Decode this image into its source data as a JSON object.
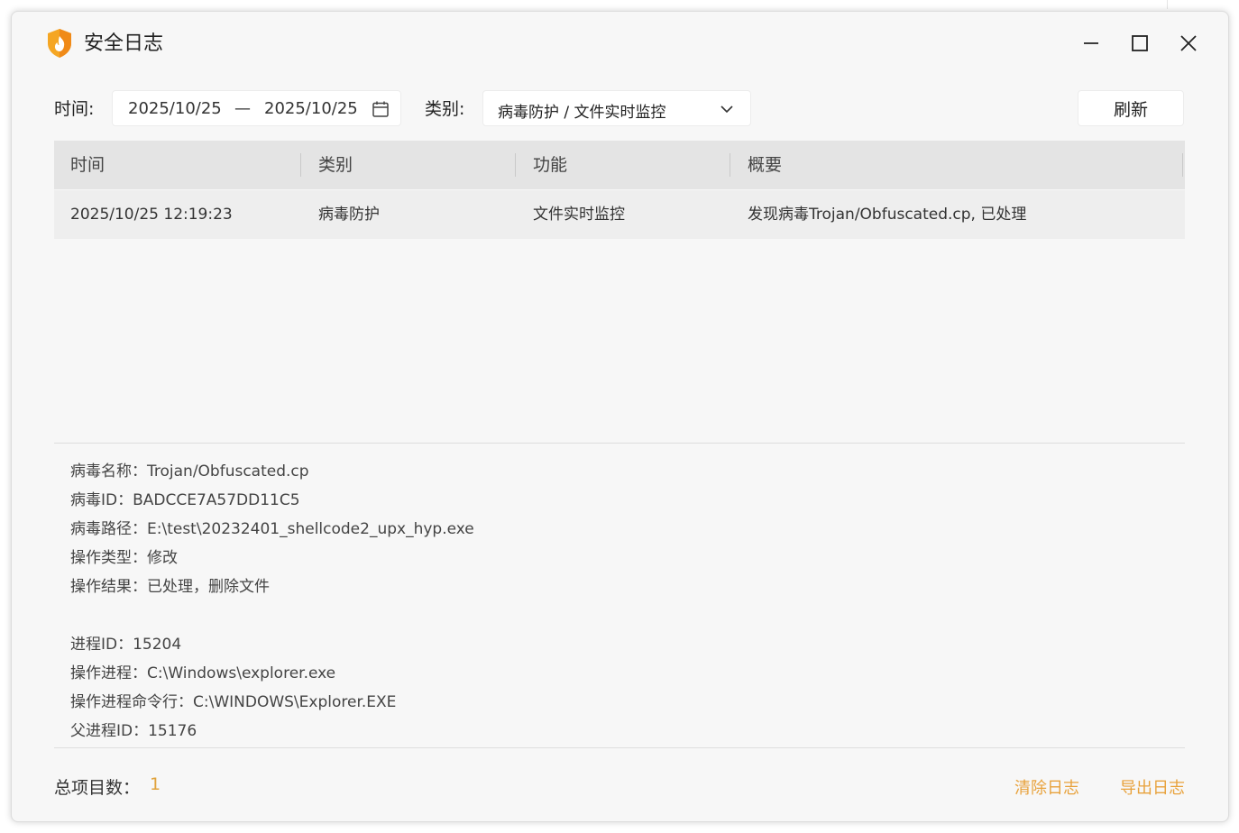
{
  "window": {
    "title": "安全日志",
    "accent_color": "#f5a623"
  },
  "toolbar": {
    "time_label": "时间:",
    "date_start": "2025/10/25",
    "date_separator": "—",
    "date_end": "2025/10/25",
    "category_label": "类别:",
    "category_value": "病毒防护 / 文件实时监控",
    "refresh_label": "刷新"
  },
  "table": {
    "columns": [
      "时间",
      "类别",
      "功能",
      "概要"
    ],
    "rows": [
      {
        "time": "2025/10/25 12:19:23",
        "category": "病毒防护",
        "function": "文件实时监控",
        "summary": "发现病毒Trojan/Obfuscated.cp, 已处理"
      }
    ]
  },
  "details": [
    "病毒名称：Trojan/Obfuscated.cp",
    "病毒ID：BADCCE7A57DD11C5",
    "病毒路径：E:\\test\\20232401_shellcode2_upx_hyp.exe",
    "操作类型：修改",
    "操作结果：已处理，删除文件",
    "",
    "进程ID：15204",
    "操作进程：C:\\Windows\\explorer.exe",
    "操作进程命令行：C:\\WINDOWS\\Explorer.EXE",
    "父进程ID：15176"
  ],
  "footer": {
    "total_label": "总项目数：",
    "total_count": "1",
    "clear_label": "清除日志",
    "export_label": "导出日志",
    "link_color": "#e8a23c"
  },
  "icons": {
    "logo": "shield-flame-icon",
    "minimize": "minimize-icon",
    "maximize": "maximize-icon",
    "close": "close-icon",
    "calendar": "calendar-icon",
    "dropdown": "chevron-down-icon"
  }
}
